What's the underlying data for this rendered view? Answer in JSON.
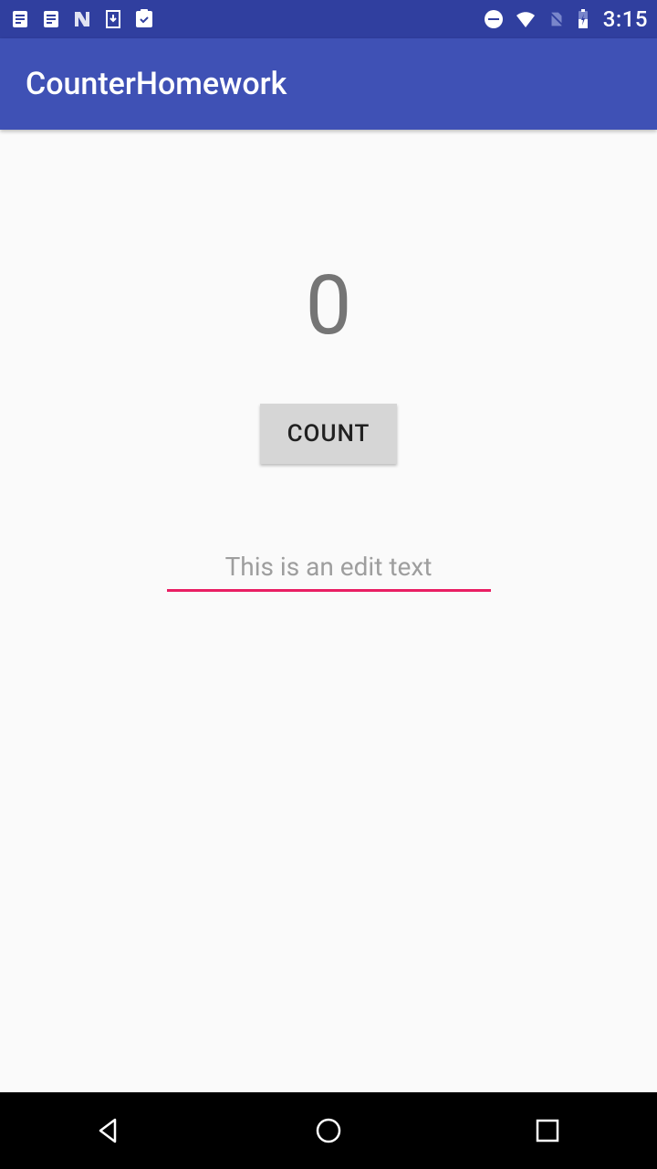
{
  "status_bar": {
    "time": "3:15"
  },
  "app_bar": {
    "title": "CounterHomework"
  },
  "main": {
    "counter_value": "0",
    "count_button_label": "COUNT",
    "edit_hint": "This is an edit text",
    "edit_value": ""
  }
}
